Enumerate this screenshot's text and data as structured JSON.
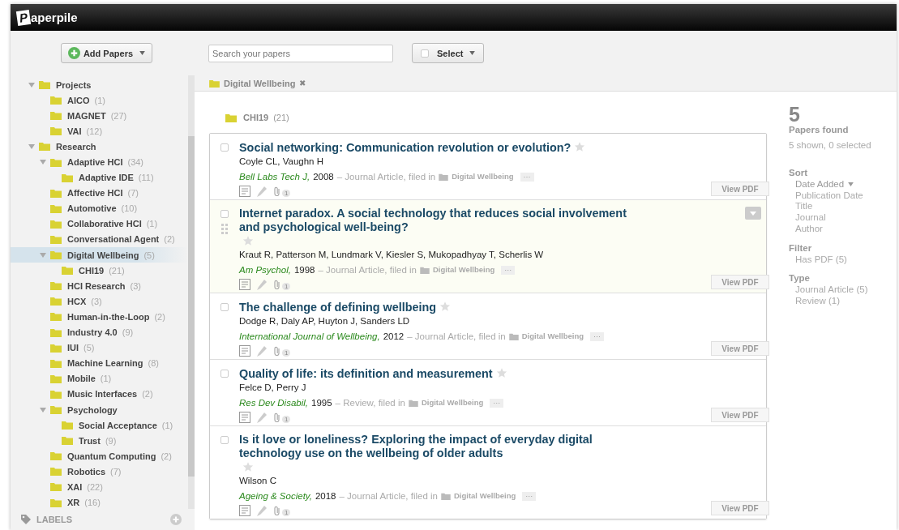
{
  "app": {
    "logo_letter": "P",
    "logo_rest": "aperpile"
  },
  "toolbar": {
    "add_button": "Add Papers",
    "search": {
      "placeholder": "Search your papers"
    },
    "select_button": {
      "label": "Select",
      "checked": false
    }
  },
  "sidebar": {
    "folders": [
      {
        "name": "Projects",
        "expanded": true,
        "selected": false,
        "children": [
          {
            "name": "AICO",
            "count": "(1)",
            "selected": false
          },
          {
            "name": "MAGNET",
            "count": "(27)",
            "selected": false
          },
          {
            "name": "VAI",
            "count": "(12)",
            "selected": false
          }
        ]
      },
      {
        "name": "Research",
        "expanded": true,
        "selected": false,
        "children": [
          {
            "name": "Adaptive HCI",
            "count": "(34)",
            "expanded": true,
            "selected": false,
            "children": [
              {
                "name": "Adaptive IDE",
                "count": "(11)",
                "selected": false
              }
            ]
          },
          {
            "name": "Affective HCI",
            "count": "(7)",
            "selected": false
          },
          {
            "name": "Automotive",
            "count": "(10)",
            "selected": false
          },
          {
            "name": "Collaborative HCI",
            "count": "(1)",
            "selected": false
          },
          {
            "name": "Conversational Agent",
            "count": "(2)",
            "selected": false
          },
          {
            "name": "Digital Wellbeing",
            "count": "(5)",
            "expanded": true,
            "selected": true,
            "children": [
              {
                "name": "CHI19",
                "count": "(21)",
                "selected": false
              }
            ]
          },
          {
            "name": "HCI Research",
            "count": "(3)",
            "selected": false
          },
          {
            "name": "HCX",
            "count": "(3)",
            "selected": false
          },
          {
            "name": "Human-in-the-Loop",
            "count": "(2)",
            "selected": false
          },
          {
            "name": "Industry 4.0",
            "count": "(9)",
            "selected": false
          },
          {
            "name": "IUI",
            "count": "(5)",
            "selected": false
          },
          {
            "name": "Machine Learning",
            "count": "(8)",
            "selected": false
          },
          {
            "name": "Mobile",
            "count": "(1)",
            "selected": false
          },
          {
            "name": "Music Interfaces",
            "count": "(2)",
            "selected": false
          },
          {
            "name": "Psychology",
            "expanded": true,
            "selected": false,
            "children": [
              {
                "name": "Social Acceptance",
                "count": "(1)",
                "selected": false
              },
              {
                "name": "Trust",
                "count": "(9)",
                "selected": false
              }
            ]
          },
          {
            "name": "Quantum Computing",
            "count": "(2)",
            "selected": false
          },
          {
            "name": "Robotics",
            "count": "(7)",
            "selected": false
          },
          {
            "name": "XAI",
            "count": "(22)",
            "selected": false
          },
          {
            "name": "XR",
            "count": "(16)",
            "selected": false
          }
        ]
      }
    ],
    "labels_heading": "LABELS"
  },
  "breadcrumb": {
    "folder": "Digital Wellbeing",
    "close": "✖"
  },
  "subfolder": {
    "name": "CHI19",
    "count": "(21)"
  },
  "papers": [
    {
      "title": "Social networking: Communication revolution or evolution?",
      "authors": "Coyle CL, Vaughn H",
      "journal": "Bell Labs Tech J,",
      "year": "2008",
      "type": "– Journal Article, filed in",
      "folder": "Digital Wellbeing",
      "more": "···",
      "attachments": "1",
      "pdf": "View PDF",
      "checked": false,
      "starred": false,
      "hovered": false
    },
    {
      "title": "Internet paradox. A social technology that reduces social involvement and psychological well-being?",
      "authors": "Kraut R, Patterson M, Lundmark V, Kiesler S, Mukopadhyay T, Scherlis W",
      "journal": "Am Psychol,",
      "year": "1998",
      "type": "– Journal Article, filed in",
      "folder": "Digital Wellbeing",
      "more": "···",
      "attachments": "1",
      "pdf": "View PDF",
      "checked": false,
      "starred": false,
      "hovered": true
    },
    {
      "title": "The challenge of defining wellbeing",
      "authors": "Dodge R, Daly AP, Huyton J, Sanders LD",
      "journal": "International Journal of Wellbeing,",
      "year": "2012",
      "type": "– Journal Article, filed in",
      "folder": "Digital Wellbeing",
      "more": "···",
      "attachments": "1",
      "pdf": "View PDF",
      "checked": false,
      "starred": false,
      "hovered": false
    },
    {
      "title": "Quality of life: its definition and measurement",
      "authors": "Felce D, Perry J",
      "journal": "Res Dev Disabil,",
      "year": "1995",
      "type": "– Review, filed in",
      "folder": "Digital Wellbeing",
      "more": "···",
      "attachments": "1",
      "pdf": "View PDF",
      "checked": false,
      "starred": false,
      "hovered": false
    },
    {
      "title": "Is it love or loneliness? Exploring the impact of everyday digital technology use on the wellbeing of older adults",
      "authors": "Wilson C",
      "journal": "Ageing & Society,",
      "year": "2018",
      "type": "– Journal Article, filed in",
      "folder": "Digital Wellbeing",
      "more": "···",
      "attachments": "1",
      "pdf": "View PDF",
      "checked": false,
      "starred": false,
      "hovered": false
    }
  ],
  "summary": {
    "count": "5",
    "label": "Papers found",
    "status": "5 shown, 0 selected",
    "sort": {
      "heading": "Sort",
      "items": [
        {
          "label": "Date Added",
          "selected": true
        },
        {
          "label": "Publication Date",
          "selected": false
        },
        {
          "label": "Title",
          "selected": false
        },
        {
          "label": "Journal",
          "selected": false
        },
        {
          "label": "Author",
          "selected": false
        }
      ]
    },
    "filter": {
      "heading": "Filter",
      "items": [
        "Has PDF (5)"
      ]
    },
    "type": {
      "heading": "Type",
      "items": [
        "Journal Article (5)",
        "Review (1)"
      ]
    }
  }
}
